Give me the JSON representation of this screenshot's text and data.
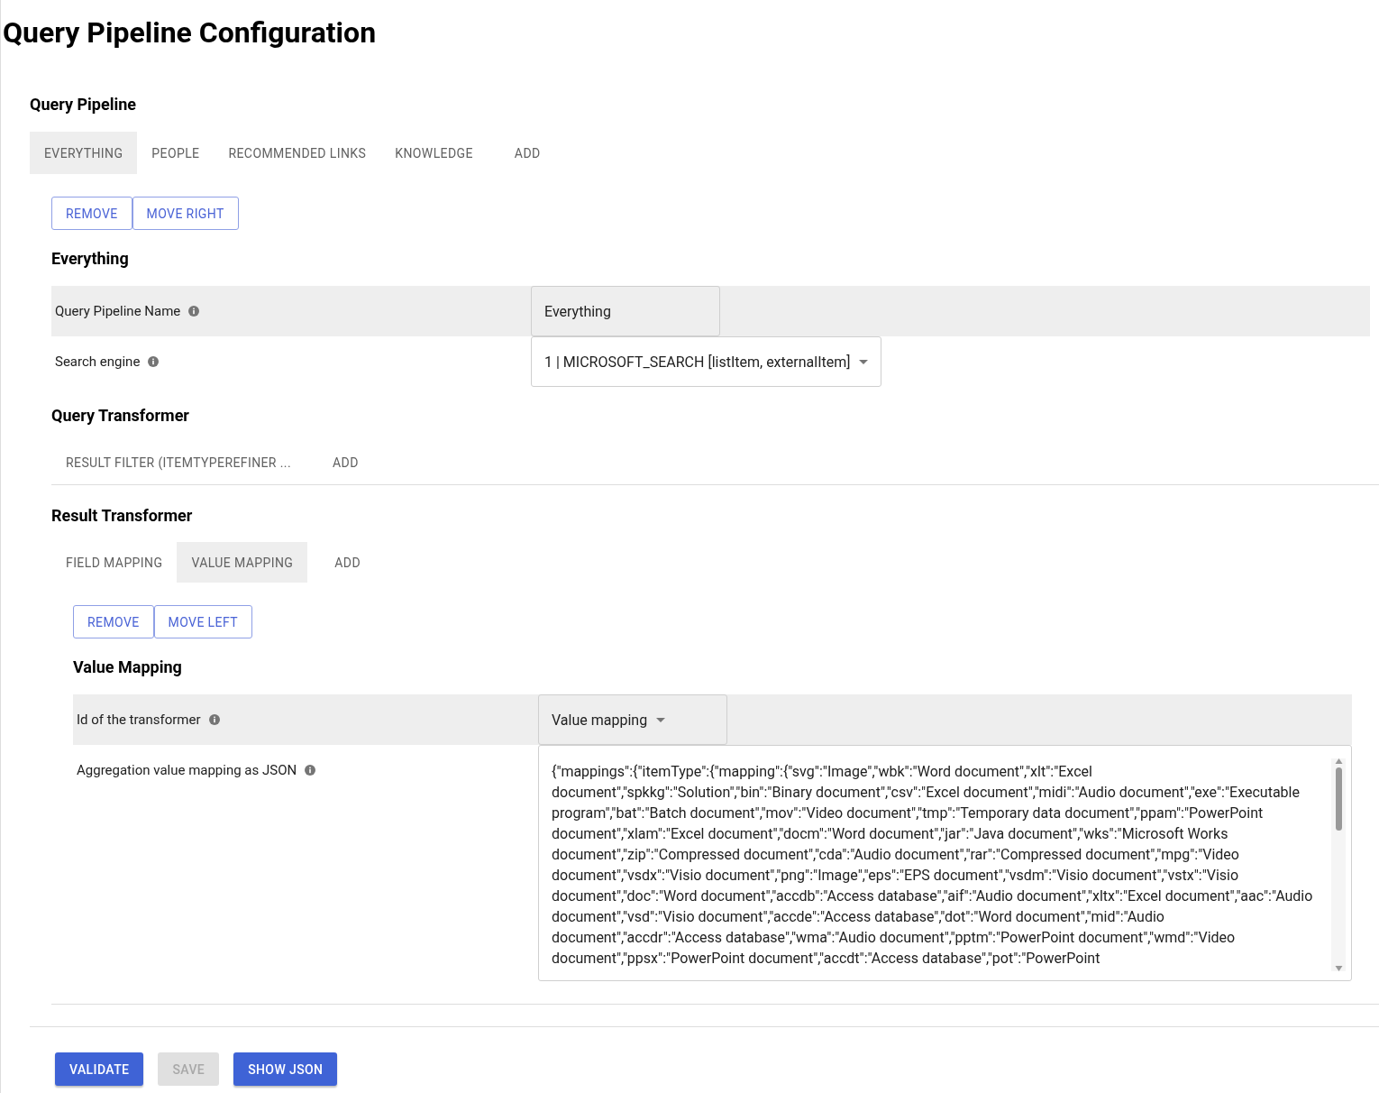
{
  "page_title": "Query Pipeline Configuration",
  "pipeline": {
    "heading": "Query Pipeline",
    "tabs": [
      {
        "label": "EVERYTHING",
        "selected": true
      },
      {
        "label": "PEOPLE",
        "selected": false
      },
      {
        "label": "RECOMMENDED LINKS",
        "selected": false
      },
      {
        "label": "KNOWLEDGE",
        "selected": false
      },
      {
        "label": "ADD",
        "selected": false
      }
    ],
    "buttons": [
      "REMOVE",
      "MOVE RIGHT"
    ],
    "heading_detail": "Everything",
    "fields": [
      {
        "label": "Query Pipeline Name",
        "kind": "text",
        "value": "Everything"
      },
      {
        "label": "Search engine",
        "kind": "select",
        "value": "1 | MICROSOFT_SEARCH [listItem, externalItem]"
      }
    ],
    "query_transformer": {
      "heading": "Query Transformer",
      "tabs": [
        {
          "label": "RESULT FILTER (ITEMTYPEREFINER ...",
          "selected": false
        },
        {
          "label": "ADD",
          "selected": false
        }
      ]
    },
    "result_transformer": {
      "heading": "Result Transformer",
      "tabs": [
        {
          "label": "FIELD MAPPING",
          "selected": false
        },
        {
          "label": "VALUE MAPPING",
          "selected": true
        },
        {
          "label": "ADD",
          "selected": false
        }
      ],
      "buttons": [
        "REMOVE",
        "MOVE LEFT"
      ],
      "heading_detail": "Value Mapping",
      "fields": [
        {
          "label": "Id of the transformer",
          "kind": "select",
          "value": "Value mapping"
        },
        {
          "label": "Aggregation value mapping as JSON",
          "kind": "textarea",
          "value": "{\"mappings\":{\"itemType\":{\"mapping\":{\"svg\":\"Image\",\"wbk\":\"Word document\",\"xlt\":\"Excel document\",\"spkkg\":\"Solution\",\"bin\":\"Binary document\",\"csv\":\"Excel document\",\"midi\":\"Audio document\",\"exe\":\"Executable program\",\"bat\":\"Batch document\",\"mov\":\"Video document\",\"tmp\":\"Temporary data document\",\"ppam\":\"PowerPoint document\",\"xlam\":\"Excel document\",\"docm\":\"Word document\",\"jar\":\"Java document\",\"wks\":\"Microsoft Works document\",\"zip\":\"Compressed document\",\"cda\":\"Audio document\",\"rar\":\"Compressed document\",\"mpg\":\"Video document\",\"vsdx\":\"Visio document\",\"png\":\"Image\",\"eps\":\"EPS document\",\"vsdm\":\"Visio document\",\"vstx\":\"Visio document\",\"doc\":\"Word document\",\"accdb\":\"Access database\",\"aif\":\"Audio document\",\"xltx\":\"Excel document\",\"aac\":\"Audio document\",\"vsd\":\"Visio document\",\"accde\":\"Access database\",\"dot\":\"Word document\",\"mid\":\"Audio document\",\"accdr\":\"Access database\",\"wma\":\"Audio document\",\"pptm\":\"PowerPoint document\",\"wmd\":\"Video document\",\"ppsx\":\"PowerPoint document\",\"accdt\":\"Access database\",\"pot\":\"PowerPoint"
        }
      ]
    }
  },
  "actions": [
    {
      "label": "VALIDATE",
      "disabled": false
    },
    {
      "label": "SAVE",
      "disabled": true
    },
    {
      "label": "SHOW JSON",
      "disabled": false
    }
  ]
}
